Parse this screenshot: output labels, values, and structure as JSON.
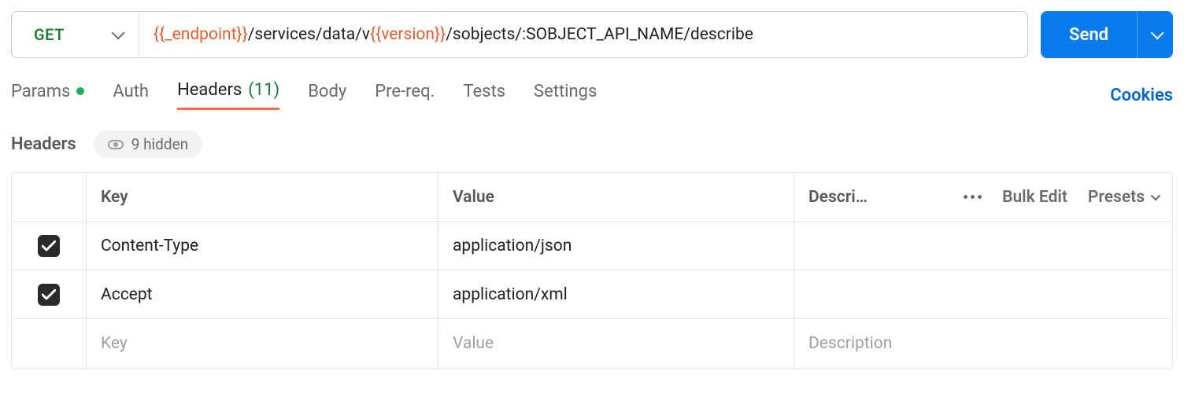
{
  "request": {
    "method": "GET",
    "url_parts": {
      "var1": "{{_endpoint}}",
      "seg1": "/services/data/v",
      "var2": "{{version}}",
      "seg2": "/sobjects/:SOBJECT_API_NAME/describe"
    },
    "send_label": "Send"
  },
  "tabs": {
    "params": "Params",
    "auth": "Auth",
    "headers": "Headers",
    "headers_count": "(11)",
    "body": "Body",
    "prereq": "Pre-req.",
    "tests": "Tests",
    "settings": "Settings",
    "cookies": "Cookies"
  },
  "headers_section": {
    "title": "Headers",
    "hidden_label": "9 hidden",
    "columns": {
      "key": "Key",
      "value": "Value",
      "desc": "Descri…"
    },
    "actions": {
      "bulk_edit": "Bulk Edit",
      "presets": "Presets"
    },
    "rows": [
      {
        "key": "Content-Type",
        "value": "application/json"
      },
      {
        "key": "Accept",
        "value": "application/xml"
      }
    ],
    "placeholders": {
      "key": "Key",
      "value": "Value",
      "desc": "Description"
    }
  }
}
